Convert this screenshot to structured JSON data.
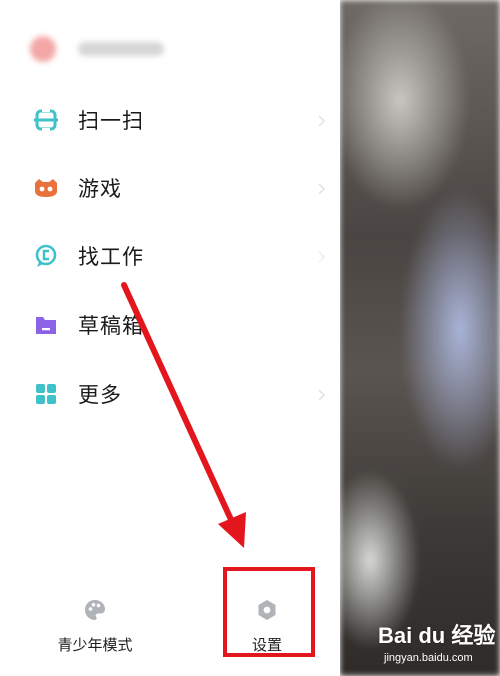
{
  "menu": {
    "items": [
      {
        "label": "扫一扫",
        "icon": "scan-icon"
      },
      {
        "label": "游戏",
        "icon": "game-icon"
      },
      {
        "label": "找工作",
        "icon": "job-search-icon"
      },
      {
        "label": "草稿箱",
        "icon": "drafts-folder-icon"
      },
      {
        "label": "更多",
        "icon": "more-grid-icon"
      }
    ]
  },
  "bottom": {
    "teen_mode_label": "青少年模式",
    "settings_label": "设置"
  },
  "watermark": {
    "brand": "Bai du 经验",
    "url": "jingyan.baidu.com"
  },
  "colors": {
    "scan": "#3fc1c9",
    "game": "#e8713c",
    "job": "#3fc1c9",
    "drafts": "#8a63e6",
    "more": "#3fc1c9",
    "annotation_red": "#e3161d"
  }
}
